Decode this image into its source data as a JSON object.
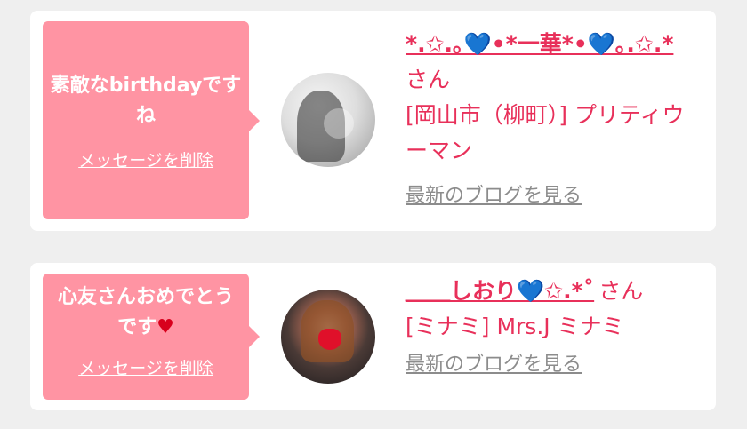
{
  "cards": [
    {
      "message": "素敵なbirthdayですね",
      "delete_label": "メッセージを削除",
      "name": "*.✩.｡💙•*一華*•💙｡.✩.*",
      "honorific": "さん",
      "shop": "[岡山市（柳町）] プリティウーマン",
      "blog_label": "最新のブログを見る"
    },
    {
      "message": "心友さんおめでとうです",
      "message_heart": "♥",
      "delete_label": "メッセージを削除",
      "name": "＿＿しおり💙✩.*˚",
      "honorific": "さん",
      "shop": "[ミナミ] Mrs.J ミナミ",
      "blog_label": "最新のブログを見る"
    }
  ],
  "colors": {
    "bubble": "#ff94a3",
    "accent": "#e8305a",
    "link_gray": "#8c8c8c",
    "background": "#efefef"
  }
}
